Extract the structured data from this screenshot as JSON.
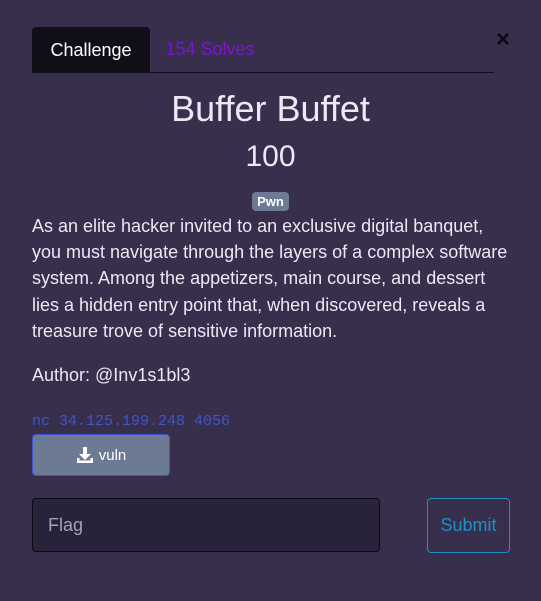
{
  "modal": {
    "close_label": "×",
    "tabs": [
      {
        "label": "Challenge",
        "active": true
      },
      {
        "label": "154 Solves",
        "active": false
      }
    ],
    "title": "Buffer Buffet",
    "points": "100",
    "tag": "Pwn",
    "description": "As an elite hacker invited to an exclusive digital banquet, you must navigate through the layers of a complex software system. Among the appetizers, main course, and dessert lies a hidden entry point that, when discovered, reveals a treasure trove of sensitive information.",
    "author": "Author: @Inv1s1bl3",
    "connection": "nc 34.125.199.248 4056",
    "download": {
      "label": "vuln",
      "icon": "download-icon"
    },
    "flag_input": {
      "placeholder": "Flag",
      "value": ""
    },
    "submit_label": "Submit"
  },
  "colors": {
    "background": "#372f4b",
    "active_tab": "#100e17",
    "solves_tab": "#7b14d6",
    "tag": "#6d7a94",
    "connection": "#3f56ce",
    "submit": "#1e8fc7"
  }
}
